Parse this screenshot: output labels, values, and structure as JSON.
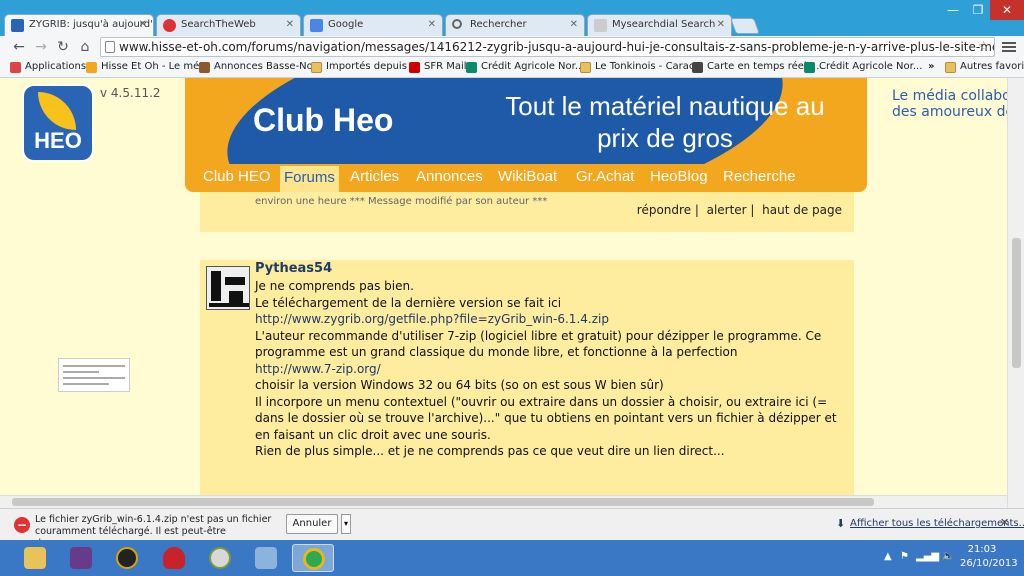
{
  "tabs": [
    {
      "title": "ZYGRIB: jusqu'à aujourd'h",
      "active": true
    },
    {
      "title": "SearchTheWeb"
    },
    {
      "title": "Google"
    },
    {
      "title": "Rechercher"
    },
    {
      "title": "Mysearchdial Search"
    }
  ],
  "toolbar": {
    "url": "www.hisse-et-oh.com/forums/navigation/messages/1416212-zygrib-jusqu-a-aujourd-hui-je-consultais-z-sans-probleme-je-n-y-arrive-plus-le-site-me-demande-"
  },
  "bookmarks": [
    "Applications",
    "Hisse Et Oh - Le mé...",
    "Annonces Basse-No...",
    "Importés depuis IE",
    "SFR Mail",
    "Crédit Agricole Nor...",
    "Le Tonkinois - Carac...",
    "Carte en temps réel ...",
    "Crédit Agricole Nor...",
    "Autres favoris"
  ],
  "site": {
    "logo_text": "HEO",
    "version": "v 4.5.11.2",
    "banner_title": "Club Heo",
    "banner_slogan": "Tout le matériel nautique au prix de gros",
    "right_slogan_line1": "Le média collabor",
    "right_slogan_line2": "des amoureux de",
    "nav": [
      "Club HEO",
      "Forums",
      "Articles",
      "Annonces",
      "WikiBoat",
      "Gr.Achat",
      "HeoBlog",
      "Recherche"
    ],
    "nav_active": "Forums"
  },
  "prev_post": {
    "meta": "environ une heure *** Message modifié par son auteur ***",
    "actions": [
      "répondre |",
      "alerter |",
      "haut de page"
    ]
  },
  "post": {
    "author": "Pytheas54",
    "lines": [
      "Je ne comprends pas bien.",
      "Le téléchargement de la dernière version se fait ici",
      "http://www.zygrib.org/getfile.php?file=zyGrib_win-6.1.4.zip",
      "L'auteur recommande d'utiliser 7-zip (logiciel libre et gratuit) pour dézipper le programme. Ce programme est un grand classique du monde libre, et fonctionne à la perfection",
      "http://www.7-zip.org/",
      "choisir la version Windows 32 ou 64 bits (so on est sous W bien sûr)",
      "Il incorpore un menu contextuel (\"ouvrir ou extraire dans un dossier à choisir, ou extraire ici (= dans le dossier où se trouve l'archive)...\" que tu obtiens en pointant vers un fichier à dézipper et en faisant un clic droit avec une souris.",
      "Rien de plus simple... et je ne comprends pas ce que veut dire un lien direct..."
    ]
  },
  "download": {
    "message": "Le fichier zyGrib_win-6.1.4.zip n'est pas un fichier couramment téléchargé. Il est peut-être dangereux.",
    "button": "Annuler",
    "show_all": "Afficher tous les téléchargements..."
  },
  "taskbar": {
    "time": "21:03",
    "date": "26/10/2013"
  },
  "colors": {
    "accent_orange": "#f2a71e",
    "brand_blue": "#1e5aa8",
    "page_bg": "#fffbd2",
    "post_bg": "#feec9f"
  }
}
